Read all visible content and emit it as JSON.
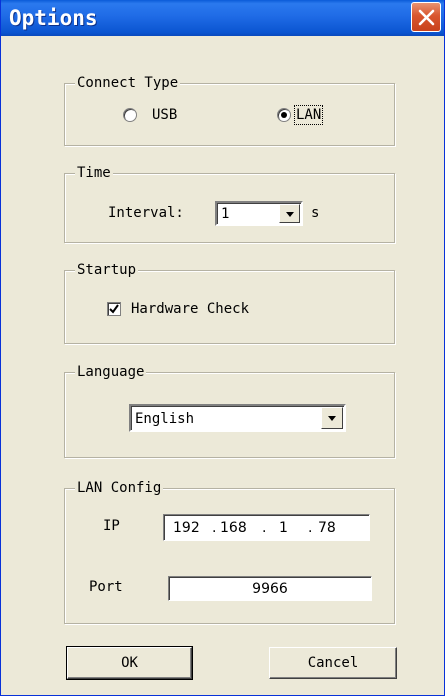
{
  "window": {
    "title": "Options"
  },
  "connect_type": {
    "legend": "Connect Type",
    "options": [
      {
        "label": "USB",
        "selected": false
      },
      {
        "label": "LAN",
        "selected": true
      }
    ]
  },
  "time": {
    "legend": "Time",
    "interval_label": "Interval:",
    "interval_value": "1",
    "unit": "s"
  },
  "startup": {
    "legend": "Startup",
    "hardware_check_label": "Hardware Check",
    "hardware_check_checked": true
  },
  "language": {
    "legend": "Language",
    "value": "English"
  },
  "lan_config": {
    "legend": "LAN Config",
    "ip_label": "IP",
    "ip": {
      "o1": "192",
      "o2": "168",
      "o3": "1",
      "o4": "78"
    },
    "port_label": "Port",
    "port_value": "9966"
  },
  "buttons": {
    "ok": "OK",
    "cancel": "Cancel"
  }
}
